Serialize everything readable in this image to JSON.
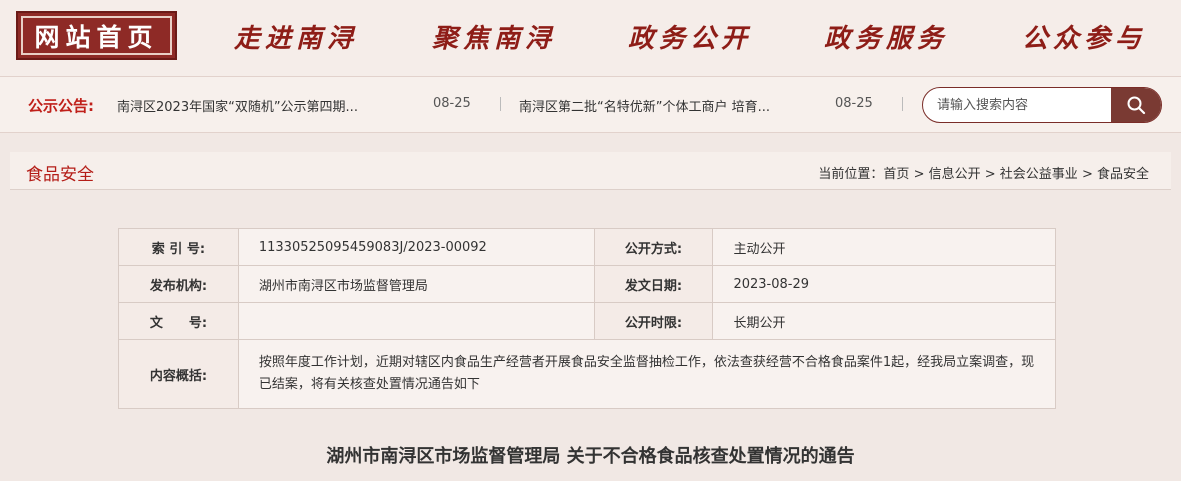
{
  "nav": {
    "home": "网站首页",
    "items": [
      "走进南浔",
      "聚焦南浔",
      "政务公开",
      "政务服务",
      "公众参与"
    ]
  },
  "notice": {
    "label": "公示公告:",
    "items": [
      {
        "title": "南浔区2023年国家“双随机”公示第四期...",
        "date": "08-25"
      },
      {
        "title": "南浔区第二批“名特优新”个体工商户 培育...",
        "date": "08-25"
      }
    ]
  },
  "search": {
    "placeholder": "请输入搜索内容",
    "icon": "search-icon"
  },
  "section": {
    "title": "食品安全",
    "breadcrumb_prefix": "当前位置：",
    "breadcrumb": [
      "首页",
      "信息公开",
      "社会公益事业",
      "食品安全"
    ]
  },
  "meta": {
    "index_label": "索 引 号:",
    "index_value": "11330525095459083J/2023-00092",
    "open_mode_label": "公开方式:",
    "open_mode_value": "主动公开",
    "org_label": "发布机构:",
    "org_value": "湖州市南浔区市场监督管理局",
    "date_label": "发文日期:",
    "date_value": "2023-08-29",
    "docno_label": "文　　号:",
    "docno_value": "",
    "period_label": "公开时限:",
    "period_value": "长期公开",
    "summary_label": "内容概括:",
    "summary_value": "按照年度工作计划，近期对辖区内食品生产经营者开展食品安全监督抽检工作，依法查获经营不合格食品案件1起，经我局立案调查，现已结案，将有关核查处置情况通告如下"
  },
  "doc_title": "湖州市南浔区市场监督管理局 关于不合格食品核查处置情况的通告",
  "colors": {
    "brand": "#8e2a26",
    "nav_text": "#8e1d17",
    "accent_red": "#c0201a",
    "background": "#f3ebe7"
  }
}
